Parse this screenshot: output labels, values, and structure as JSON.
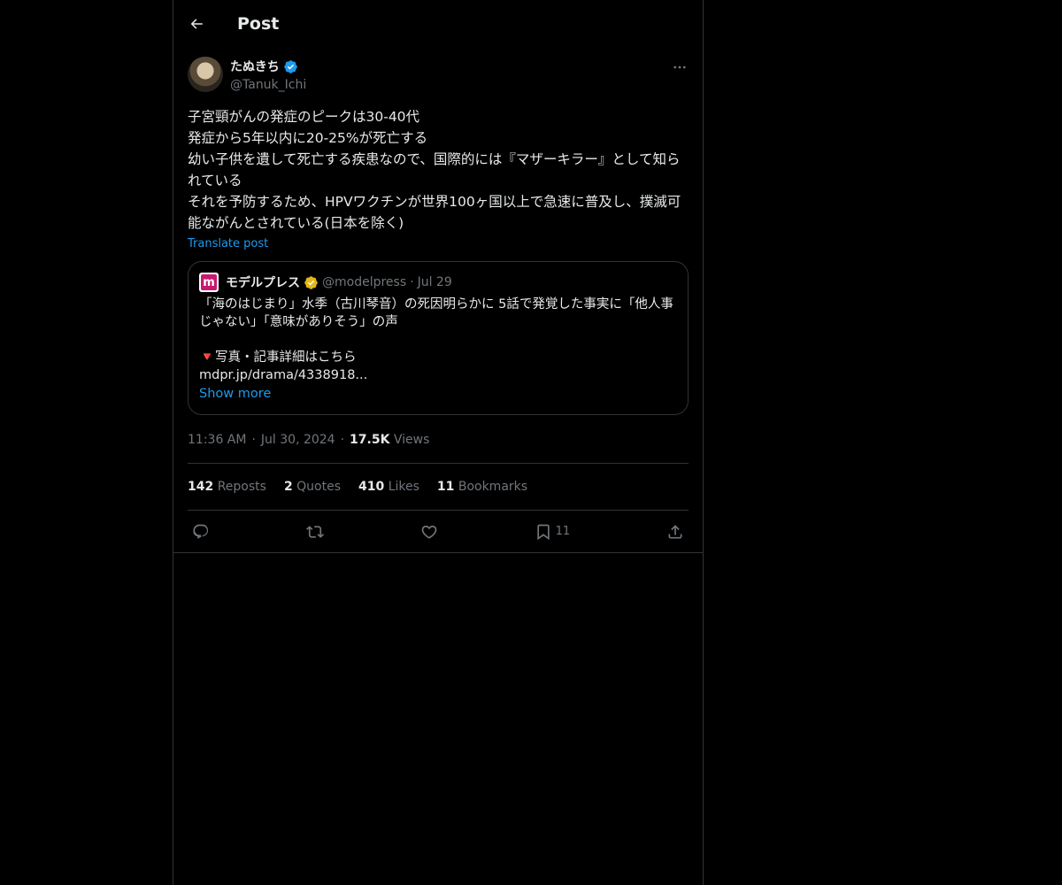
{
  "header": {
    "title": "Post"
  },
  "author": {
    "name": "たぬきち",
    "handle": "@Tanuk_Ichi"
  },
  "post": {
    "text": "子宮頸がんの発症のピークは30-40代\n発症から5年以内に20-25%が死亡する\n幼い子供を遺して死亡する疾患なので、国際的には『マザーキラー』として知られている\nそれを予防するため、HPVワクチンが世界100ヶ国以上で急速に普及し、撲滅可能ながんとされている(日本を除く)",
    "translate_label": "Translate post"
  },
  "quote": {
    "name": "モデルプレス",
    "handle": "@modelpress",
    "separator": "·",
    "date": "Jul 29",
    "text": "「海のはじまり」水季（古川琴音）の死因明らかに 5話で発覚した事実に「他人事じゃない」「意味がありそう」の声\n\n🔻写真・記事詳細はこちら\nmdpr.jp/drama/4338918...",
    "show_more": "Show more",
    "logo_letter": "m"
  },
  "meta": {
    "time": "11:36 AM",
    "sep1": "·",
    "date": "Jul 30, 2024",
    "sep2": "·",
    "views_count": "17.5K",
    "views_label": "Views"
  },
  "stats": {
    "reposts": {
      "count": "142",
      "label": "Reposts"
    },
    "quotes": {
      "count": "2",
      "label": "Quotes"
    },
    "likes": {
      "count": "410",
      "label": "Likes"
    },
    "bookmarks": {
      "count": "11",
      "label": "Bookmarks"
    }
  },
  "actions": {
    "bookmark_count": "11"
  },
  "colors": {
    "accent": "#1d9bf0",
    "verified_blue": "#1d9bf0",
    "verified_gold": "#e2b719",
    "background": "#000000",
    "border": "#2f3336",
    "muted": "#71767b"
  },
  "icons": [
    "back-arrow-icon",
    "verified-badge-icon",
    "more-icon",
    "reply-icon",
    "repost-icon",
    "like-icon",
    "bookmark-icon",
    "share-icon"
  ]
}
